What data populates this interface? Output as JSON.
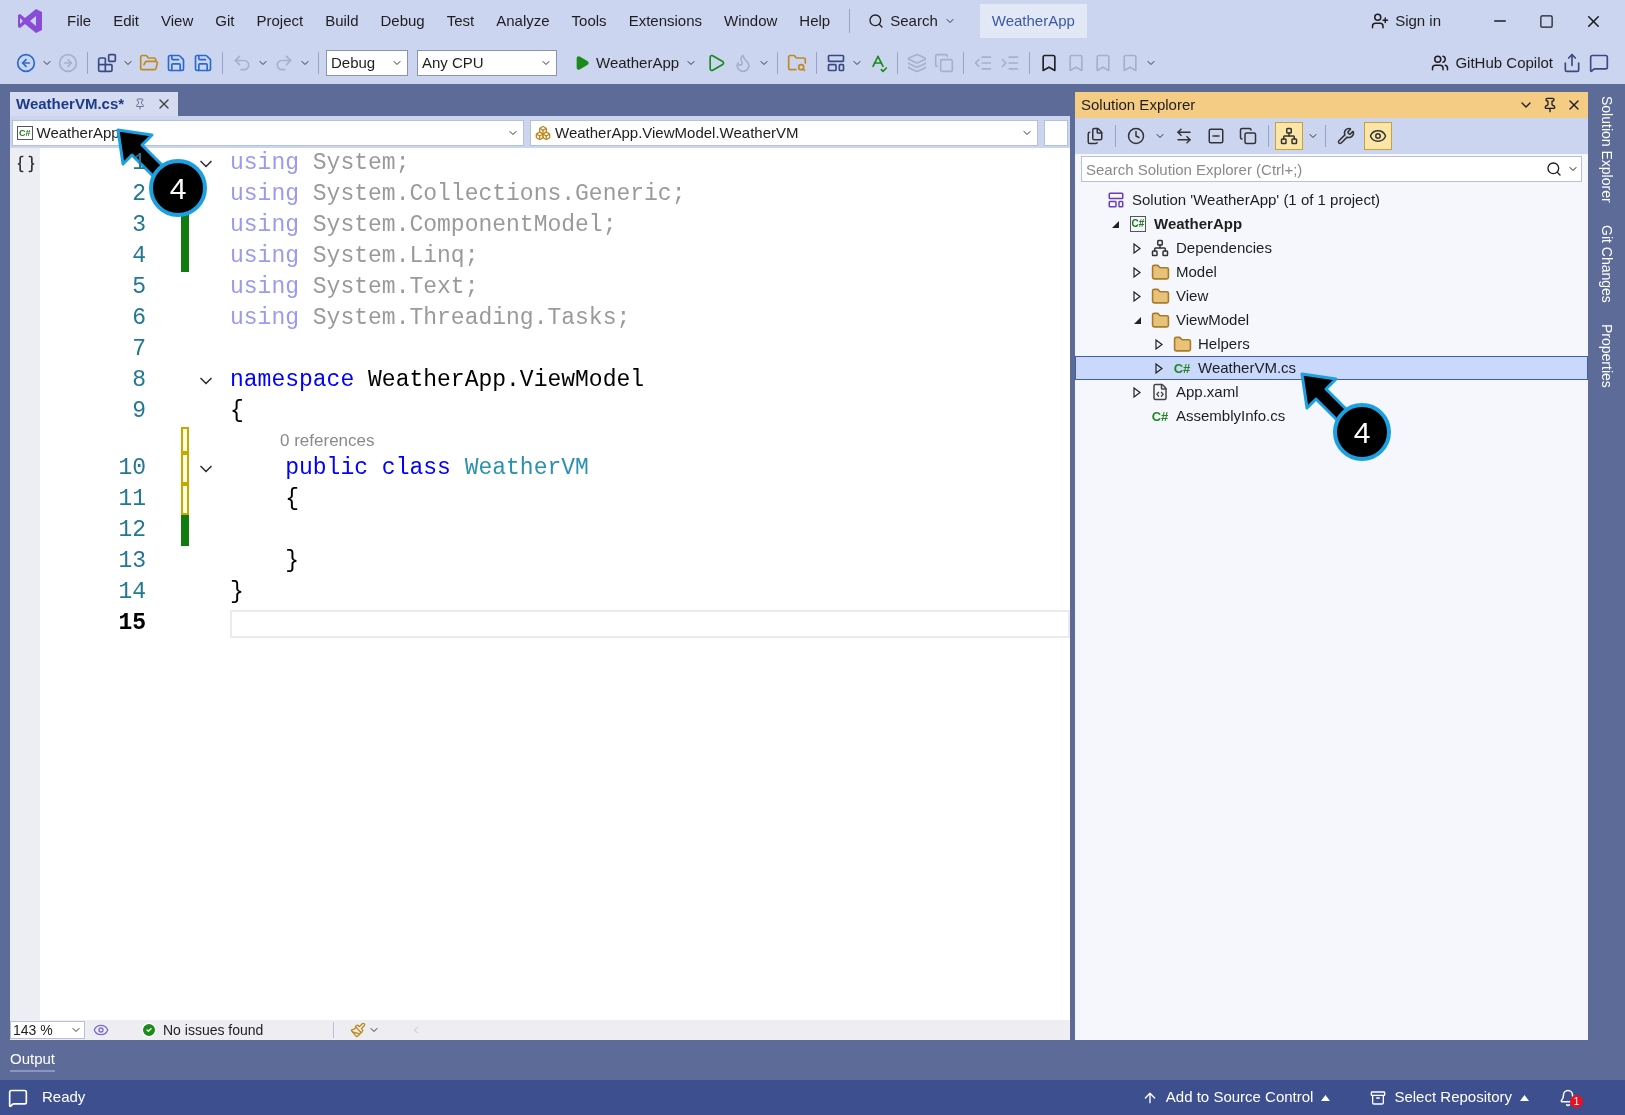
{
  "menu": [
    "File",
    "Edit",
    "View",
    "Git",
    "Project",
    "Build",
    "Debug",
    "Test",
    "Analyze",
    "Tools",
    "Extensions",
    "Window",
    "Help"
  ],
  "search": {
    "label": "Search"
  },
  "solution_name": "WeatherApp",
  "sign_in": "Sign in",
  "toolbar": {
    "configuration": "Debug",
    "platform": "Any CPU",
    "start_target": "WeatherApp",
    "copilot": "GitHub Copilot"
  },
  "editor": {
    "tab": {
      "title": "WeatherVM.cs*",
      "selected": true
    },
    "project_icon": "C#",
    "project_dropdown": "WeatherApp",
    "scope_dropdown": "WeatherApp.ViewModel.WeatherVM",
    "lines": [
      {
        "number": "1",
        "current": false,
        "fold": true,
        "tokens": [
          {
            "kind": "faded-keyword",
            "text": "using"
          },
          {
            "kind": "faded",
            "text": " System;"
          }
        ]
      },
      {
        "number": "2",
        "current": false,
        "tokens": [
          {
            "kind": "faded-keyword",
            "text": "using"
          },
          {
            "kind": "faded",
            "text": " System.Collections.Generic;"
          }
        ]
      },
      {
        "number": "3",
        "current": false,
        "saved": true,
        "tokens": [
          {
            "kind": "faded-keyword",
            "text": "using"
          },
          {
            "kind": "faded",
            "text": " System.ComponentModel;"
          }
        ]
      },
      {
        "number": "4",
        "current": false,
        "saved": true,
        "tokens": [
          {
            "kind": "faded-keyword",
            "text": "using"
          },
          {
            "kind": "faded",
            "text": " System.Linq;"
          }
        ]
      },
      {
        "number": "5",
        "current": false,
        "tokens": [
          {
            "kind": "faded-keyword",
            "text": "using"
          },
          {
            "kind": "faded",
            "text": " System.Text;"
          }
        ]
      },
      {
        "number": "6",
        "current": false,
        "tokens": [
          {
            "kind": "faded-keyword",
            "text": "using"
          },
          {
            "kind": "faded",
            "text": " System.Threading.Tasks;"
          }
        ]
      },
      {
        "number": "7",
        "current": false
      },
      {
        "number": "8",
        "current": false,
        "fold": true,
        "tokens": [
          {
            "kind": "keyword",
            "text": "namespace"
          },
          {
            "kind": "plain",
            "text": " WeatherApp.ViewModel"
          }
        ]
      },
      {
        "number": "9",
        "current": false,
        "tokens": [
          {
            "kind": "plain",
            "text": "{"
          }
        ]
      },
      {
        "number": "10",
        "current": false,
        "lens": "0 references",
        "fold": true,
        "saved": false,
        "tokens": [
          {
            "kind": "keyword",
            "text": "    public class"
          },
          {
            "kind": "type",
            "text": " WeatherVM"
          }
        ]
      },
      {
        "number": "11",
        "current": false,
        "saved": false,
        "tokens": [
          {
            "kind": "plain",
            "text": "    {"
          }
        ]
      },
      {
        "number": "12",
        "current": false,
        "saved": true
      },
      {
        "number": "13",
        "current": false,
        "tokens": [
          {
            "kind": "plain",
            "text": "    }"
          }
        ]
      },
      {
        "number": "14",
        "current": false,
        "tokens": [
          {
            "kind": "plain",
            "text": "}"
          }
        ]
      },
      {
        "number": "15",
        "current": true
      }
    ],
    "zoom": "143 %",
    "issues": "No issues found"
  },
  "solution_explorer": {
    "title": "Solution Explorer",
    "search": {
      "placeholder": "Search Solution Explorer (Ctrl+;)"
    },
    "tools": [
      {
        "kind": "switch-views",
        "on": false
      },
      {
        "kind": "pending-changes",
        "on": false
      },
      {
        "kind": "sync",
        "on": false
      },
      {
        "kind": "collapse",
        "on": false
      },
      {
        "kind": "show-all",
        "on": false
      },
      {
        "kind": "tree-view",
        "on": true
      },
      {
        "kind": "properties",
        "on": false
      },
      {
        "kind": "preview",
        "on": true
      }
    ],
    "tree": [
      {
        "label": "Solution 'WeatherApp' (1 of 1 project)",
        "kind": "solution",
        "selected": false,
        "children": [
          {
            "label": "WeatherApp",
            "kind": "project",
            "icon_text": "C#",
            "expanded": true,
            "selected": false,
            "children": [
              {
                "label": "Dependencies",
                "kind": "dependencies",
                "expanded": false,
                "selected": false
              },
              {
                "label": "Model",
                "kind": "folder",
                "expanded": false,
                "selected": false
              },
              {
                "label": "View",
                "kind": "folder",
                "expanded": false,
                "selected": false
              },
              {
                "label": "ViewModel",
                "kind": "folder",
                "expanded": true,
                "selected": false,
                "children": [
                  {
                    "label": "Helpers",
                    "kind": "folder",
                    "expanded": false,
                    "selected": false
                  },
                  {
                    "label": "WeatherVM.cs",
                    "kind": "csharp",
                    "icon_text": "C#",
                    "expanded": false,
                    "selected": true
                  }
                ]
              },
              {
                "label": "App.xaml",
                "kind": "xaml",
                "expanded": false,
                "selected": false
              },
              {
                "label": "AssemblyInfo.cs",
                "kind": "csharp",
                "icon_text": "C#",
                "selected": false
              }
            ]
          }
        ]
      }
    ]
  },
  "side_tabs": [
    "Solution Explorer",
    "Git Changes",
    "Properties"
  ],
  "output_tab": "Output",
  "status_bar": {
    "status": "Ready",
    "source_control": "Add to Source Control",
    "repository": "Select Repository",
    "notifications": "1"
  },
  "callouts": [
    {
      "label": "4"
    },
    {
      "label": "4"
    }
  ]
}
